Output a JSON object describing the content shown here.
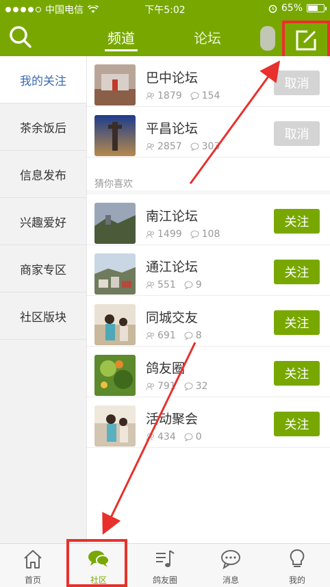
{
  "status_bar": {
    "carrier": "中国电信",
    "time": "下午5:02",
    "battery": "65%",
    "battery_level": 0.65
  },
  "header": {
    "tabs": [
      {
        "label": "频道",
        "active": true
      },
      {
        "label": "论坛",
        "active": false
      }
    ],
    "search_icon": "search-icon",
    "compose_icon": "compose-icon"
  },
  "sidebar": {
    "items": [
      {
        "label": "我的关注",
        "active": true
      },
      {
        "label": "茶余饭后",
        "active": false
      },
      {
        "label": "信息发布",
        "active": false
      },
      {
        "label": "兴趣爱好",
        "active": false
      },
      {
        "label": "商家专区",
        "active": false
      },
      {
        "label": "社区版块",
        "active": false
      }
    ]
  },
  "followed": [
    {
      "name": "巴中论坛",
      "members": "1879",
      "posts": "154",
      "action": "取消"
    },
    {
      "name": "平昌论坛",
      "members": "2857",
      "posts": "303",
      "action": "取消"
    }
  ],
  "section_label": "猜你喜欢",
  "suggested": [
    {
      "name": "南江论坛",
      "members": "1499",
      "posts": "108",
      "action": "关注"
    },
    {
      "name": "通江论坛",
      "members": "551",
      "posts": "9",
      "action": "关注"
    },
    {
      "name": "同城交友",
      "members": "691",
      "posts": "8",
      "action": "关注"
    },
    {
      "name": "鸽友圈",
      "members": "791",
      "posts": "32",
      "action": "关注"
    },
    {
      "name": "活动聚会",
      "members": "434",
      "posts": "0",
      "action": "关注"
    }
  ],
  "bottom_nav": [
    {
      "label": "首页",
      "icon": "home-icon",
      "active": false
    },
    {
      "label": "社区",
      "icon": "chat-bubbles-icon",
      "active": true
    },
    {
      "label": "鸽友圈",
      "icon": "music-list-icon",
      "active": false
    },
    {
      "label": "消息",
      "icon": "message-icon",
      "active": false
    },
    {
      "label": "我的",
      "icon": "bulb-icon",
      "active": false
    }
  ],
  "colors": {
    "brand_green": "#78a800",
    "annotation_red": "#e8302c",
    "sidebar_active_text": "#3b6cb0"
  }
}
